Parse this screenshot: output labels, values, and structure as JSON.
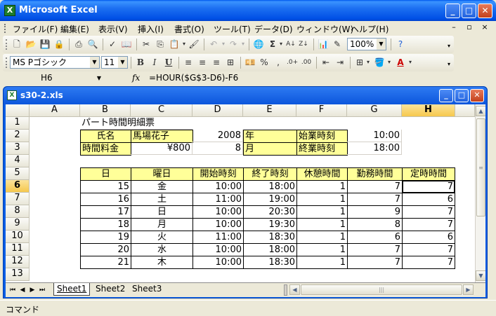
{
  "app": {
    "title": "Microsoft Excel",
    "icon_letter": "X"
  },
  "menu": [
    "ファイル(F)",
    "編集(E)",
    "表示(V)",
    "挿入(I)",
    "書式(O)",
    "ツール(T)",
    "データ(D)",
    "ウィンドウ(W)",
    "ヘルプ(H)"
  ],
  "toolbar": {
    "zoom": "100%",
    "font_name": "MS Pゴシック",
    "font_size": "11"
  },
  "formula_bar": {
    "name_box": "H6",
    "fx": "fx",
    "formula": "=HOUR($G$3-D6)-F6"
  },
  "workbook": {
    "title": "s30-2.xls"
  },
  "columns": [
    "A",
    "B",
    "C",
    "D",
    "E",
    "F",
    "G",
    "H"
  ],
  "rows": [
    "1",
    "2",
    "3",
    "4",
    "5",
    "6",
    "7",
    "8",
    "9",
    "10",
    "11",
    "12",
    "13"
  ],
  "cells": {
    "title": "パート時間明細票",
    "name_label": "氏名",
    "name_value": "馬場花子",
    "year_value": "2008",
    "year_label": "年",
    "start_label": "始業時刻",
    "start_value": "10:00",
    "wage_label": "時間料金",
    "wage_value": "¥800",
    "month_value": "8",
    "month_label": "月",
    "end_label": "終業時刻",
    "end_value": "18:00"
  },
  "table": {
    "headers": [
      "日",
      "曜日",
      "開始時刻",
      "終了時刻",
      "休憩時間",
      "勤務時間",
      "定時時間"
    ],
    "rows": [
      [
        "15",
        "金",
        "10:00",
        "18:00",
        "1",
        "7",
        "7"
      ],
      [
        "16",
        "土",
        "11:00",
        "19:00",
        "1",
        "7",
        "6"
      ],
      [
        "17",
        "日",
        "10:00",
        "20:30",
        "1",
        "9",
        "7"
      ],
      [
        "18",
        "月",
        "10:00",
        "19:30",
        "1",
        "8",
        "7"
      ],
      [
        "19",
        "火",
        "11:00",
        "18:30",
        "1",
        "6",
        "6"
      ],
      [
        "20",
        "水",
        "10:00",
        "18:00",
        "1",
        "7",
        "7"
      ],
      [
        "21",
        "木",
        "10:00",
        "18:30",
        "1",
        "7",
        "7"
      ]
    ]
  },
  "sheets": [
    "Sheet1",
    "Sheet2",
    "Sheet3"
  ],
  "status": "コマンド",
  "colors": {
    "highlight": "#ffff99",
    "title_blue": "#0058ee"
  }
}
